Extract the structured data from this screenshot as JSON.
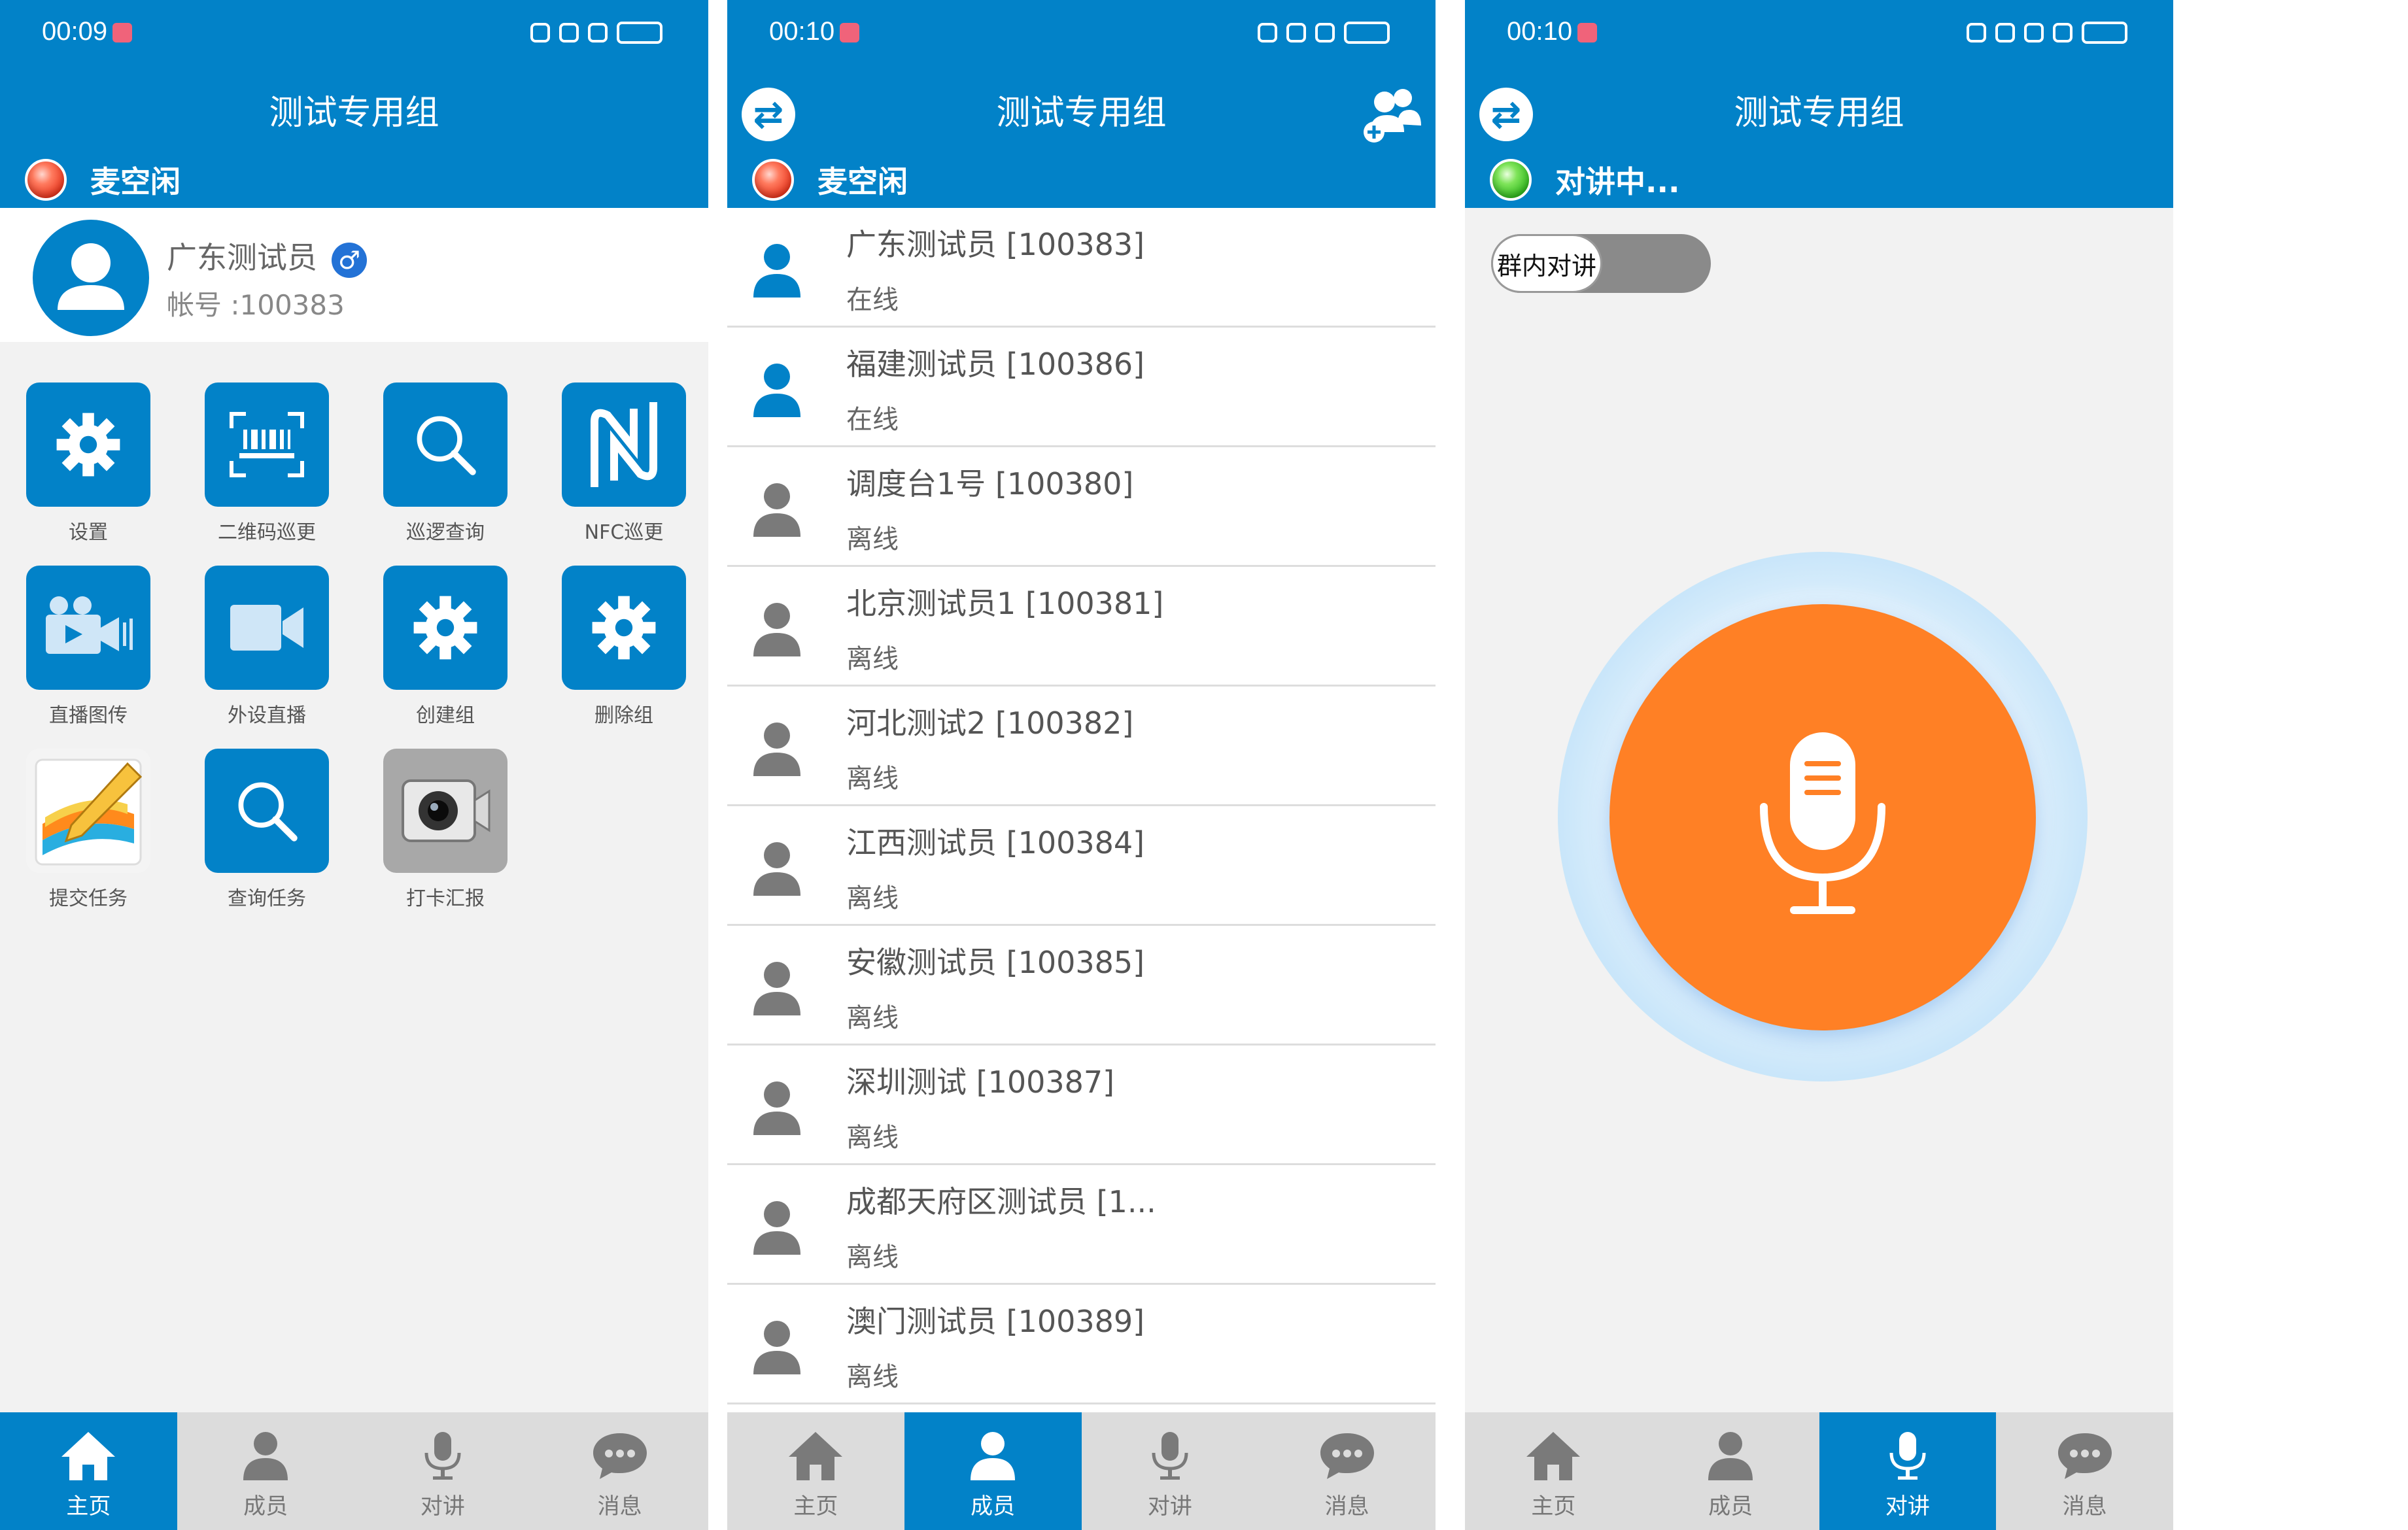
{
  "status_bar": {
    "p1_time": "00:09",
    "p2_time": "00:10",
    "p3_time": "00:10"
  },
  "group_title": "测试专用组",
  "mic_idle": "麦空闲",
  "mic_talking": "对讲中...",
  "profile": {
    "name": "广东测试员",
    "gender_symbol": "♂",
    "account": "帐号 :100383"
  },
  "home_grid": [
    {
      "label": "设置",
      "icon": "gear-icon"
    },
    {
      "label": "二维码巡更",
      "icon": "barcode-scan-icon"
    },
    {
      "label": "巡逻查询",
      "icon": "search-icon"
    },
    {
      "label": "NFC巡更",
      "icon": "nfc-icon"
    },
    {
      "label": "直播图传",
      "icon": "video-camera-broadcast-icon"
    },
    {
      "label": "外设直播",
      "icon": "video-camera-icon"
    },
    {
      "label": "创建组",
      "icon": "gear-icon"
    },
    {
      "label": "删除组",
      "icon": "gear-icon"
    },
    {
      "label": "提交任务",
      "icon": "pencil-note-icon"
    },
    {
      "label": "查询任务",
      "icon": "search-icon"
    },
    {
      "label": "打卡汇报",
      "icon": "camera-icon"
    }
  ],
  "members": [
    {
      "name": "广东测试员 [100383]",
      "status": "在线",
      "online": true
    },
    {
      "name": "福建测试员 [100386]",
      "status": "在线",
      "online": true
    },
    {
      "name": "调度台1号 [100380]",
      "status": "离线",
      "online": false
    },
    {
      "name": "北京测试员1 [100381]",
      "status": "离线",
      "online": false
    },
    {
      "name": "河北测试2 [100382]",
      "status": "离线",
      "online": false
    },
    {
      "name": "江西测试员 [100384]",
      "status": "离线",
      "online": false
    },
    {
      "name": "安徽测试员 [100385]",
      "status": "离线",
      "online": false
    },
    {
      "name": "深圳测试 [100387]",
      "status": "离线",
      "online": false
    },
    {
      "name": "成都天府区测试员 [1...",
      "status": "离线",
      "online": false
    },
    {
      "name": "澳门测试员 [100389]",
      "status": "离线",
      "online": false
    }
  ],
  "intercom": {
    "toggle_label": "群内对讲"
  },
  "nav": {
    "home": "主页",
    "members": "成员",
    "intercom": "对讲",
    "messages": "消息"
  },
  "colors": {
    "primary": "#0282c8",
    "ptt_orange": "#ff8025",
    "nav_bg": "#dcdcdc"
  }
}
